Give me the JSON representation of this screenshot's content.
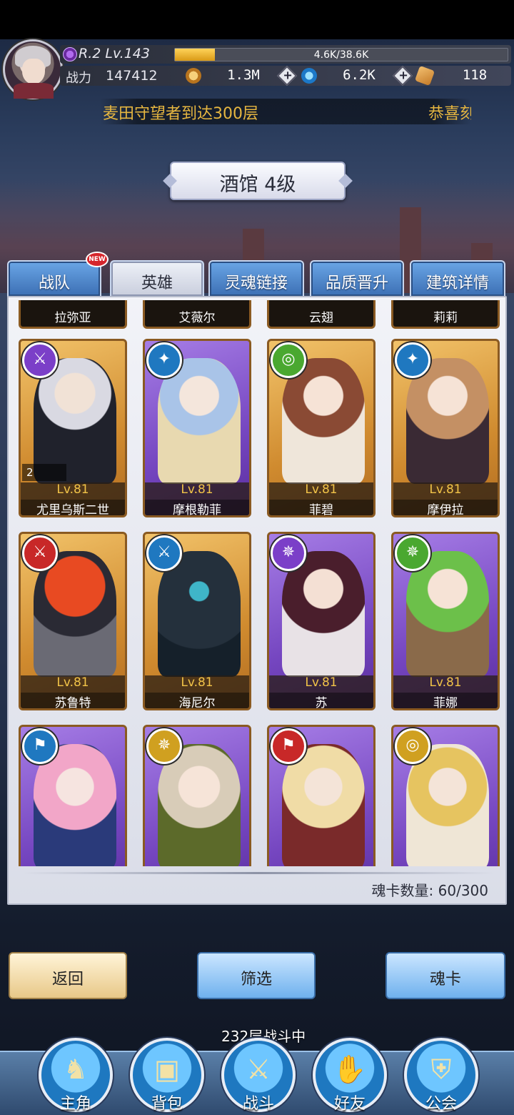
{
  "player": {
    "rank_level": "R.2 Lv.143",
    "exp_text": "4.6K/38.6K",
    "exp_fraction": 0.12,
    "power_label": "战力",
    "power_value": "147412"
  },
  "resources": [
    {
      "name": "gold",
      "value": "1.3M",
      "color": "#d09a3a"
    },
    {
      "name": "gem",
      "value": "6.2K",
      "color": "#2aa0e6"
    },
    {
      "name": "ticket",
      "value": "118",
      "color": "#e0a14a"
    }
  ],
  "marquee": {
    "text_a": "麦田守望者到达300层",
    "text_b": "恭喜刻"
  },
  "building_title": "酒馆 4级",
  "tabs": [
    {
      "label": "战队",
      "badge": "NEW"
    },
    {
      "label": "英雄"
    },
    {
      "label": "灵魂链接"
    },
    {
      "label": "品质晋升"
    },
    {
      "label": "建筑详情"
    }
  ],
  "top_row_names": [
    "拉弥亚",
    "艾薇尔",
    "云翅",
    "莉莉"
  ],
  "heroes": [
    {
      "name": "尤里乌斯二世",
      "level": "Lv.81",
      "frame": "gold",
      "badge": "sword-icon",
      "badge_color": "#7b3fc8",
      "stars": "2"
    },
    {
      "name": "摩根勒菲",
      "level": "Lv.81",
      "frame": "purple",
      "badge": "wings-icon",
      "badge_color": "#1f78c0"
    },
    {
      "name": "菲碧",
      "level": "Lv.81",
      "frame": "gold",
      "badge": "magnifier-icon",
      "badge_color": "#4aa830"
    },
    {
      "name": "摩伊拉",
      "level": "Lv.81",
      "frame": "gold",
      "badge": "wings-icon",
      "badge_color": "#1f78c0"
    },
    {
      "name": "苏鲁特",
      "level": "Lv.81",
      "frame": "gold",
      "badge": "sword-icon",
      "badge_color": "#c82828"
    },
    {
      "name": "海尼尔",
      "level": "Lv.81",
      "frame": "gold",
      "badge": "sword-icon",
      "badge_color": "#1f78c0"
    },
    {
      "name": "苏",
      "level": "Lv.81",
      "frame": "purple",
      "badge": "shuriken-icon",
      "badge_color": "#7b3fc8"
    },
    {
      "name": "菲娜",
      "level": "Lv.81",
      "frame": "purple",
      "badge": "shuriken-icon",
      "badge_color": "#4aa830"
    },
    {
      "name": "",
      "level": "",
      "frame": "purple",
      "badge": "flag-icon",
      "badge_color": "#1f78c0"
    },
    {
      "name": "",
      "level": "",
      "frame": "purple",
      "badge": "shuriken-icon",
      "badge_color": "#d0a020"
    },
    {
      "name": "",
      "level": "",
      "frame": "purple",
      "badge": "flag-icon",
      "badge_color": "#c82828"
    },
    {
      "name": "",
      "level": "",
      "frame": "purple",
      "badge": "magnifier-icon",
      "badge_color": "#d0a020"
    }
  ],
  "card_count": "魂卡数量: 60/300",
  "buttons": {
    "back": "返回",
    "filter": "筛选",
    "soul_card": "魂卡"
  },
  "battle_status": "232层战斗中",
  "nav": [
    {
      "label": "主角",
      "icon": "helmet-icon"
    },
    {
      "label": "背包",
      "icon": "backpack-icon"
    },
    {
      "label": "战斗",
      "icon": "crossed-swords-icon"
    },
    {
      "label": "好友",
      "icon": "handshake-icon"
    },
    {
      "label": "公会",
      "icon": "guild-crest-icon"
    }
  ]
}
